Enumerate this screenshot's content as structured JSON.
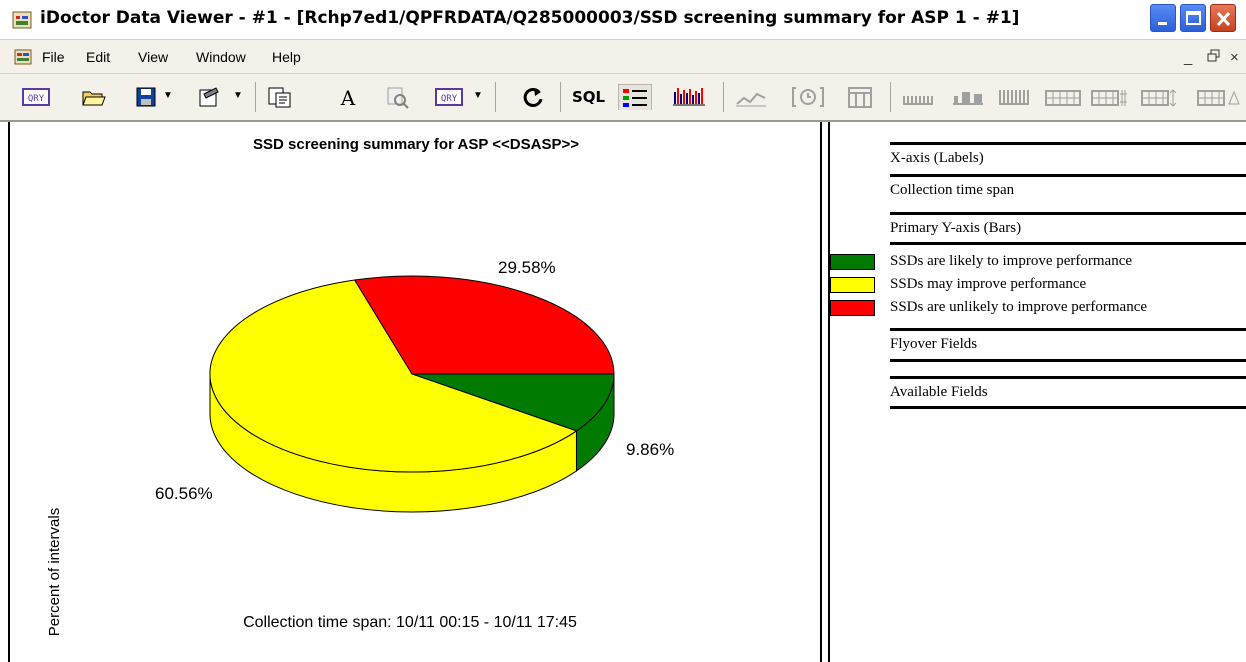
{
  "window": {
    "title": "iDoctor Data Viewer - #1 - [Rchp7ed1/QPFRDATA/Q285000003/SSD screening summary for ASP 1 - #1]"
  },
  "menu": {
    "items": [
      "File",
      "Edit",
      "View",
      "Window",
      "Help"
    ],
    "mdi_min": "_",
    "mdi_restore": "ᐱ",
    "mdi_close": "×"
  },
  "toolbar": {
    "sql_label": "SQL"
  },
  "chart_data": {
    "type": "pie",
    "title": "SSD screening summary for ASP <<DSASP>>",
    "ylabel": "Percent of intervals",
    "xlabel": "Collection time span: 10/11 00:15 - 10/11 17:45",
    "slices": [
      {
        "label": "SSDs are likely to improve performance",
        "value": 9.86,
        "display": "9.86%",
        "color": "#007a00"
      },
      {
        "label": "SSDs may improve performance",
        "value": 60.56,
        "display": "60.56%",
        "color": "#ffff00"
      },
      {
        "label": "SSDs are unlikely to improve performance",
        "value": 29.58,
        "display": "29.58%",
        "color": "#ff0000"
      }
    ]
  },
  "legend": {
    "x_axis_header": "X-axis (Labels)",
    "x_axis_value": "Collection time span",
    "primary_y_header": "Primary Y-axis (Bars)",
    "flyover_header": "Flyover Fields",
    "available_header": "Available Fields"
  }
}
